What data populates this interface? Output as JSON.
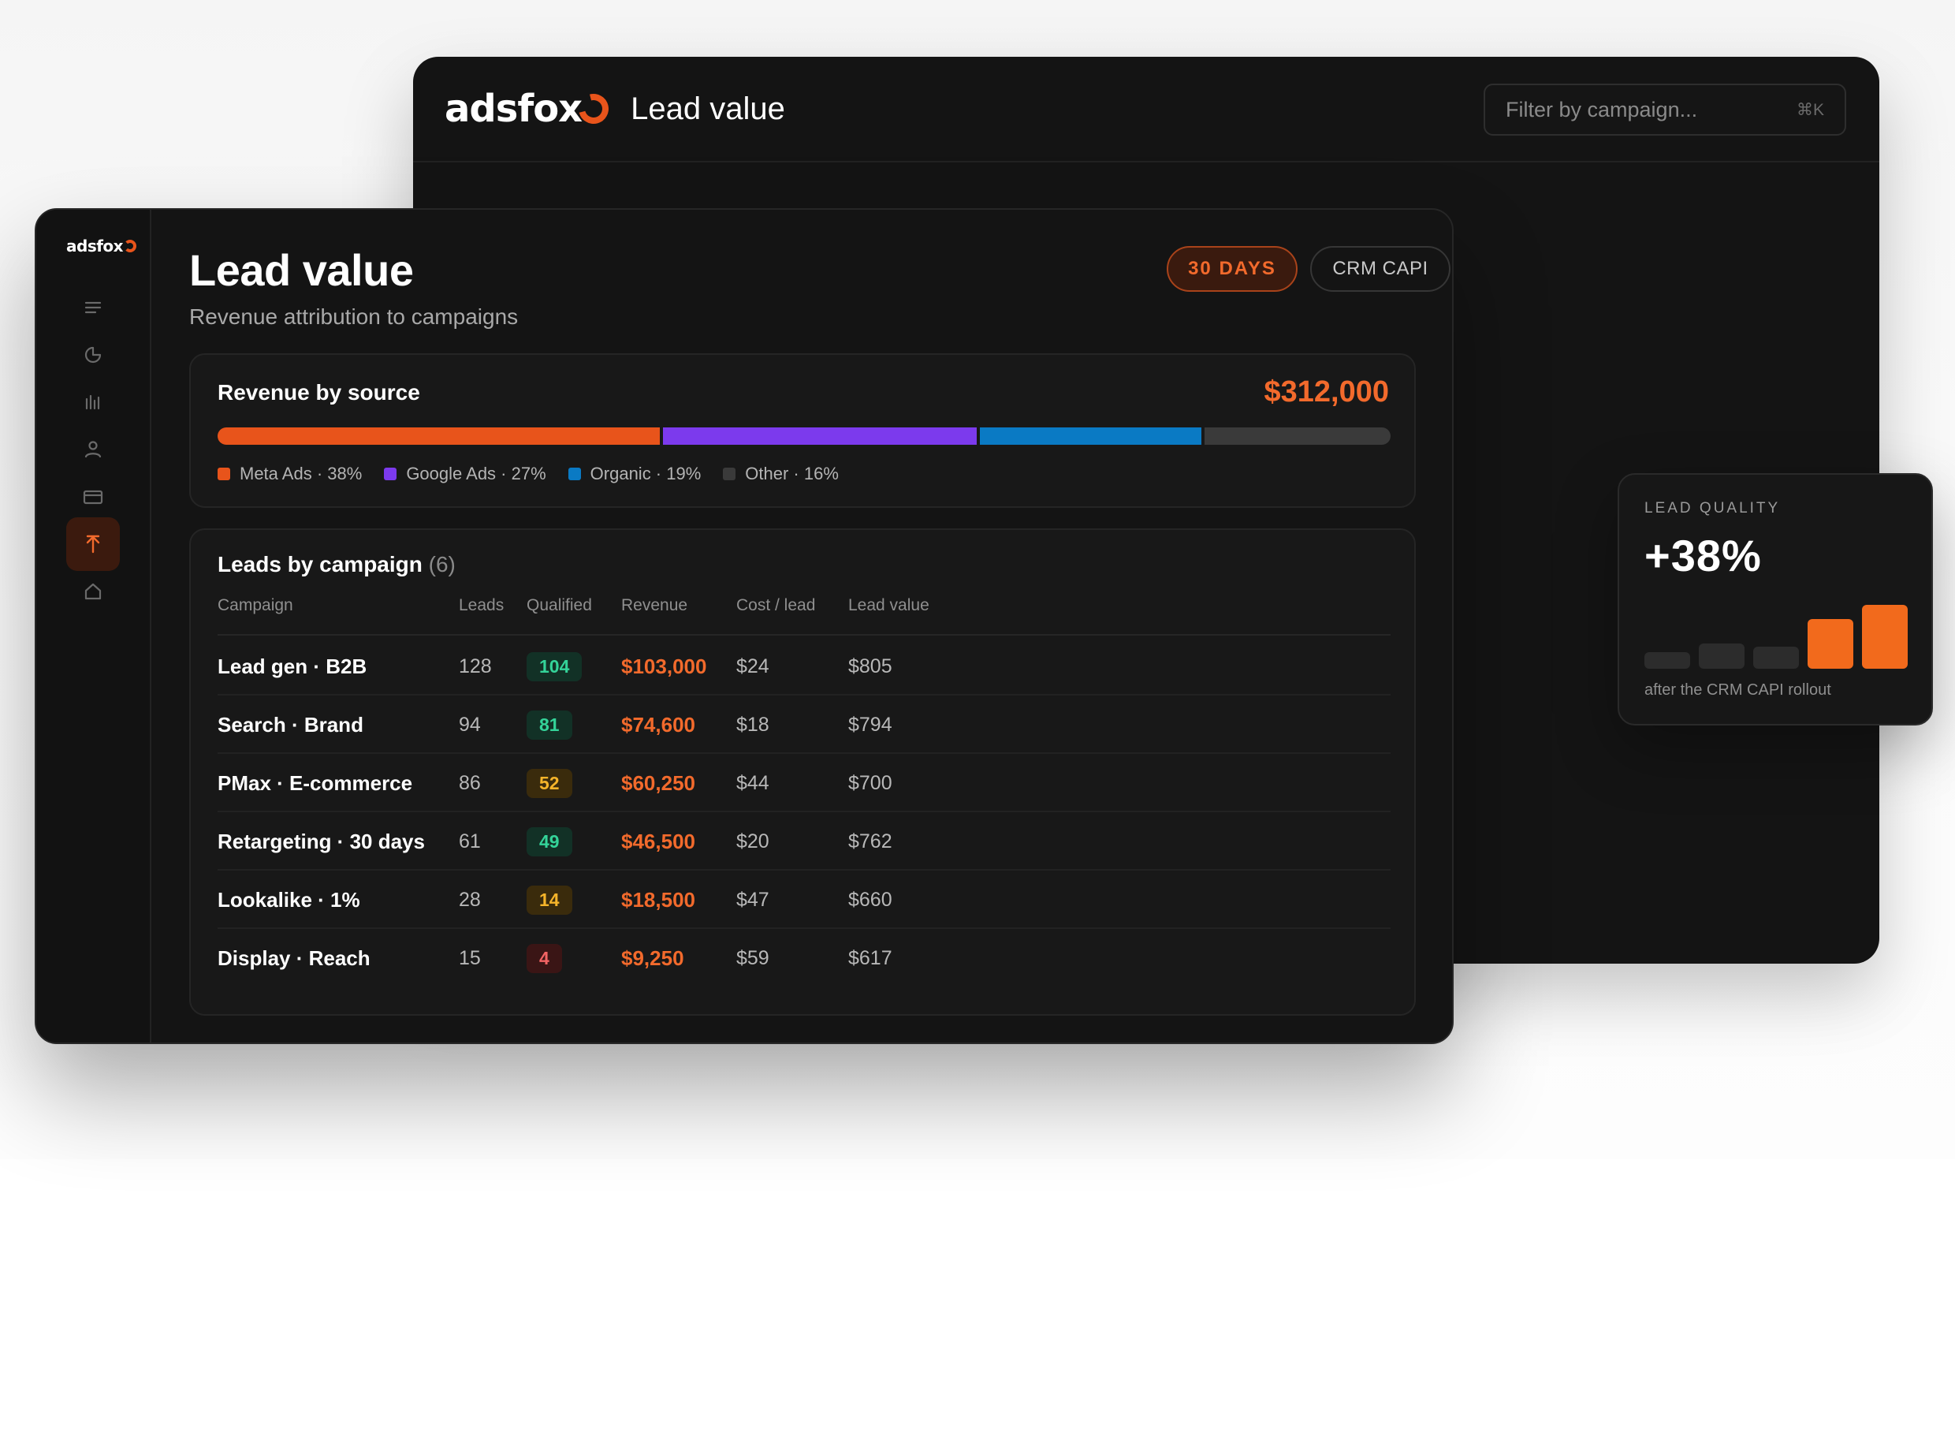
{
  "back_window": {
    "logo": "adsfox",
    "title": "Lead value",
    "search_placeholder": "Filter by campaign...",
    "search_shortcut": "⌘K"
  },
  "sidebar": {
    "logo": "adsfox",
    "items": [
      {
        "icon": "menu-icon",
        "active": false
      },
      {
        "icon": "pie-chart-icon",
        "active": false
      },
      {
        "icon": "bar-chart-icon",
        "active": false
      },
      {
        "icon": "user-icon",
        "active": false
      },
      {
        "icon": "card-icon",
        "active": false
      },
      {
        "icon": "arrow-up-icon",
        "active": true
      },
      {
        "icon": "home-icon",
        "active": false
      }
    ]
  },
  "page": {
    "title": "Lead value",
    "subtitle": "Revenue attribution to campaigns",
    "chip_days": "30 DAYS",
    "chip_crm": "CRM CAPI"
  },
  "revenue": {
    "title": "Revenue by source",
    "total": "$312,000",
    "sources": [
      {
        "label": "Meta Ads · 38%",
        "share": 38,
        "color": "#e8541b"
      },
      {
        "label": "Google Ads · 27%",
        "share": 27,
        "color": "#7c3aed"
      },
      {
        "label": "Organic · 19%",
        "share": 19,
        "color": "#0a7ac4"
      },
      {
        "label": "Other · 16%",
        "share": 16,
        "color": "#3a3a3a"
      }
    ]
  },
  "table": {
    "title": "Leads by campaign",
    "count": "(6)",
    "columns": [
      "Campaign",
      "Leads",
      "Qualified",
      "Revenue",
      "Cost / lead",
      "Lead value"
    ],
    "rows": [
      {
        "campaign": "Lead gen · B2B",
        "leads": "128",
        "qualified": "104",
        "qual_level": "g",
        "revenue": "$103,000",
        "cost": "$24",
        "value": "$805"
      },
      {
        "campaign": "Search · Brand",
        "leads": "94",
        "qualified": "81",
        "qual_level": "g",
        "revenue": "$74,600",
        "cost": "$18",
        "value": "$794"
      },
      {
        "campaign": "PMax · E-commerce",
        "leads": "86",
        "qualified": "52",
        "qual_level": "y",
        "revenue": "$60,250",
        "cost": "$44",
        "value": "$700"
      },
      {
        "campaign": "Retargeting · 30 days",
        "leads": "61",
        "qualified": "49",
        "qual_level": "g",
        "revenue": "$46,500",
        "cost": "$20",
        "value": "$762"
      },
      {
        "campaign": "Lookalike · 1%",
        "leads": "28",
        "qualified": "14",
        "qual_level": "y",
        "revenue": "$18,500",
        "cost": "$47",
        "value": "$660"
      },
      {
        "campaign": "Display · Reach",
        "leads": "15",
        "qualified": "4",
        "qual_level": "r",
        "revenue": "$9,250",
        "cost": "$59",
        "value": "$617"
      }
    ]
  },
  "quality": {
    "label": "LEAD QUALITY",
    "value": "+38%",
    "note": "after the CRM CAPI rollout",
    "bars": [
      {
        "level": 0.22,
        "color": "#2c2c2c"
      },
      {
        "level": 0.33,
        "color": "#2c2c2c"
      },
      {
        "level": 0.29,
        "color": "#2c2c2c"
      },
      {
        "level": 0.66,
        "color": "#f26a1c"
      },
      {
        "level": 0.84,
        "color": "#f26a1c"
      }
    ]
  },
  "colors": {
    "accent": "#f26a2c",
    "background": "#141414",
    "good": "#34d399",
    "warn": "#f5b42a",
    "bad": "#f26464"
  }
}
